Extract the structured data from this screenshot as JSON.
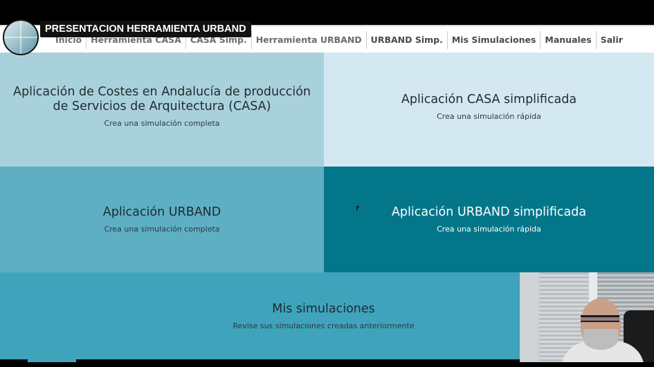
{
  "overlay": {
    "video_title": "PRESENTACION HERRAMIENTA URBAND"
  },
  "nav": {
    "items": [
      {
        "label": "Inicio",
        "obscured": true
      },
      {
        "label": "Herramienta CASA",
        "obscured": true
      },
      {
        "label": "CASA Simp.",
        "obscured": true
      },
      {
        "label": "Herramienta URBAND",
        "obscured": false
      },
      {
        "label": "URBAND Simp.",
        "obscured": false
      },
      {
        "label": "Mis Simulaciones",
        "obscured": false
      },
      {
        "label": "Manuales",
        "obscured": false
      },
      {
        "label": "Salir",
        "obscured": false
      }
    ]
  },
  "tiles": {
    "casa": {
      "title": "Aplicación de Costes en Andalucía de producción de Servicios de Arquitectura (CASA)",
      "subtitle": "Crea una simulación completa",
      "color": "#a9d1dc"
    },
    "casa_simp": {
      "title": "Aplicación CASA simplificada",
      "subtitle": "Crea una simulación rápida",
      "color": "#d4e8f1"
    },
    "urband": {
      "title": "Aplicación URBAND",
      "subtitle": "Crea una simulación completa",
      "color": "#5eafc4"
    },
    "urband_simp": {
      "title": "Aplicación URBAND simplificada",
      "subtitle": "Crea una simulación rápida",
      "color": "#04768a"
    },
    "mis": {
      "title": "Mis simulaciones",
      "subtitle": "Revise sus simulaciones creadas anteriormente",
      "color": "#3fa3bc"
    }
  }
}
